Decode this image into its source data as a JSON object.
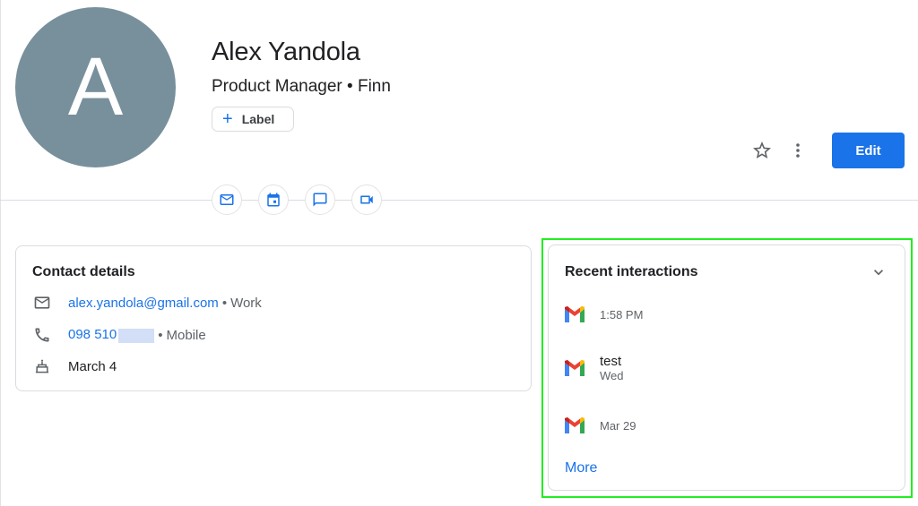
{
  "profile": {
    "avatar_initial": "A",
    "avatar_color": "#78909c",
    "name": "Alex Yandola",
    "subtitle": "Product Manager • Finn",
    "label_button": "Label"
  },
  "quick_actions": [
    {
      "name": "email",
      "icon": "mail-icon"
    },
    {
      "name": "schedule",
      "icon": "calendar-icon"
    },
    {
      "name": "chat",
      "icon": "chat-icon"
    },
    {
      "name": "video",
      "icon": "video-icon"
    }
  ],
  "toolbar": {
    "star_icon": "star-outline-icon",
    "more_icon": "more-vert-icon",
    "edit_label": "Edit",
    "accent_color": "#1a73e8"
  },
  "contact_details": {
    "title": "Contact details",
    "email": {
      "value": "alex.yandola@gmail.com",
      "type": "Work",
      "icon": "mail-icon"
    },
    "phone": {
      "value": "098 510",
      "redacted": true,
      "type": "Mobile",
      "icon": "phone-icon"
    },
    "birthday": {
      "value": "March 4",
      "icon": "cake-icon"
    }
  },
  "recent_interactions": {
    "title": "Recent interactions",
    "collapse_icon": "chevron-down-icon",
    "items": [
      {
        "source": "gmail",
        "title": "",
        "time": "1:58 PM"
      },
      {
        "source": "gmail",
        "title": "test",
        "time": "Wed"
      },
      {
        "source": "gmail",
        "title": "",
        "time": "Mar 29"
      }
    ],
    "more_label": "More"
  },
  "separator": "•"
}
